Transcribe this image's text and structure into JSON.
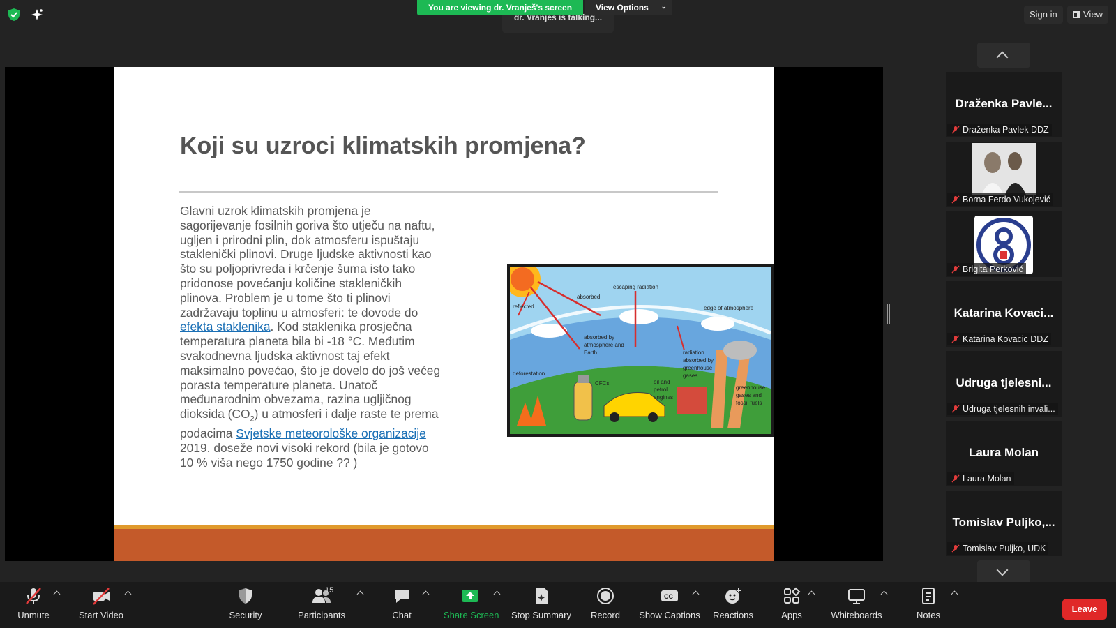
{
  "top": {
    "banner": "You are viewing dr. Vranješ's screen",
    "view_options": "View Options",
    "talking": "dr. Vranješ is talking...",
    "sign_in": "Sign in",
    "view": "View"
  },
  "slide": {
    "title": "Koji su uzroci klimatskih promjena?",
    "body_1": "Glavni uzrok klimatskih promjena je sagorijevanje  fosilnih goriva što utječu na naftu, ugljen i prirodni plin, dok atmosferu ispuštaju staklenički plinovi. Druge ljudske aktivnosti kao što su poljoprivreda i krčenje šuma isto tako pridonose povećanju količine stakleničkih plinova. Problem je u tome što ti plinovi zadržavaju toplinu u atmosferi: te dovode do ",
    "link_1": "efekta staklenika",
    "body_2": ". Kod staklenika prosječna temperatura planeta bila bi -18 °C. Međutim svakodnevna ljudska aktivnost taj efekt maksimalno povećao, što je dovelo do još većeg porasta temperature planeta. Unatoč međunarodnim obvezama, razina ugljičnog dioksida (CO",
    "sub": "2",
    "body_3": ") u atmosferi i dalje raste te  prema podacima ",
    "link_2": "Svjetske meteorološke organizacije",
    "body_4": " 2019. doseže novi visoki rekord (bila je gotovo 10 % viša nego 1750 godine    ?? )",
    "diagram_labels": {
      "reflected": "reflected",
      "absorbed": "absorbed",
      "escaping": "escaping radiation",
      "edge": "edge of atmosphere",
      "absorbed_by_1": "absorbed by",
      "absorbed_by_2": "atmosphere and",
      "absorbed_by_3": "Earth",
      "radiation_1": "radiation",
      "radiation_2": "absorbed by",
      "radiation_3": "greenhouse",
      "radiation_4": "gases",
      "deforestation": "deforestation",
      "cfcs": "CFCs",
      "oil_1": "oil and",
      "oil_2": "petrol",
      "oil_3": "engines",
      "gh_1": "greenhouse",
      "gh_2": "gases and",
      "gh_3": "fossil fuels"
    }
  },
  "gallery": [
    {
      "big": "Draženka  Pavle...",
      "label": "Draženka Pavlek DDZ",
      "kind": "name"
    },
    {
      "big": "",
      "label": "Borna Ferdo Vukojević",
      "kind": "photo"
    },
    {
      "big": "",
      "label": "Brigita Perković",
      "kind": "logo"
    },
    {
      "big": "Katarina  Kovaci...",
      "label": "Katarina Kovacic DDZ",
      "kind": "name"
    },
    {
      "big": "Udruga  tjelesni...",
      "label": "Udruga tjelesnih invali...",
      "kind": "name"
    },
    {
      "big": "Laura Molan",
      "label": "Laura Molan",
      "kind": "name"
    },
    {
      "big": "Tomislav  Puljko,...",
      "label": "Tomislav Puljko, UDK",
      "kind": "name"
    }
  ],
  "toolbar": {
    "unmute": "Unmute",
    "start_video": "Start Video",
    "security": "Security",
    "participants": "Participants",
    "participants_count": "15",
    "chat": "Chat",
    "share_screen": "Share Screen",
    "stop_summary": "Stop Summary",
    "record": "Record",
    "show_captions": "Show Captions",
    "reactions": "Reactions",
    "apps": "Apps",
    "whiteboards": "Whiteboards",
    "notes": "Notes",
    "leave": "Leave"
  },
  "colors": {
    "banner_green": "#1db954",
    "share_green": "#1db954",
    "leave_red": "#e02828",
    "link_blue": "#1a6fb5",
    "slide_footer": "#c45a2a"
  }
}
